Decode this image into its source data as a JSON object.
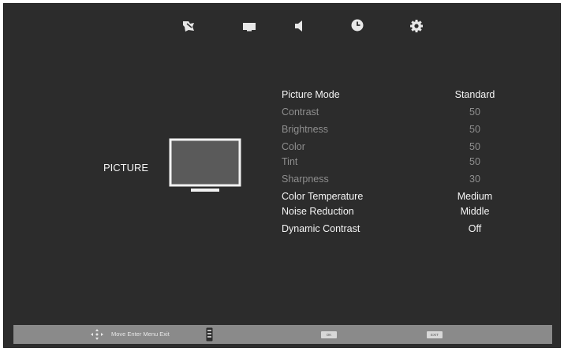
{
  "top_menu": {
    "icons": [
      {
        "name": "picture-tab-icon",
        "label": ""
      },
      {
        "name": "screen-tab-icon",
        "label": ""
      },
      {
        "name": "sound-tab-icon",
        "label": ""
      },
      {
        "name": "time-tab-icon",
        "label": ""
      },
      {
        "name": "setup-tab-icon",
        "label": ""
      }
    ]
  },
  "section": {
    "title": "PICTURE"
  },
  "menu": {
    "items": [
      {
        "label": "Picture Mode",
        "value": "Standard",
        "state": "active"
      },
      {
        "label": "Contrast",
        "value": "50",
        "state": "dim"
      },
      {
        "label": "Brightness",
        "value": "50",
        "state": "dim"
      },
      {
        "label": "Color",
        "value": "50",
        "state": "dim"
      },
      {
        "label": "Tint",
        "value": "50",
        "state": "dim"
      },
      {
        "label": "Sharpness",
        "value": "30",
        "state": "dim"
      },
      {
        "label": "Color Temperature",
        "value": "Medium",
        "state": "active"
      },
      {
        "label": "Noise Reduction",
        "value": "Middle",
        "state": "active"
      },
      {
        "label": "Dynamic Contrast",
        "value": "Off",
        "state": "active"
      }
    ]
  },
  "footer": {
    "hint": "Move Enter Menu Exit",
    "key1": "OK",
    "key2": "EXIT"
  },
  "colors": {
    "background": "#2c2c2c",
    "active_text": "#f4f4f4",
    "dim_text": "#8e8e8e",
    "bottom_bar": "#8a8a8a"
  }
}
